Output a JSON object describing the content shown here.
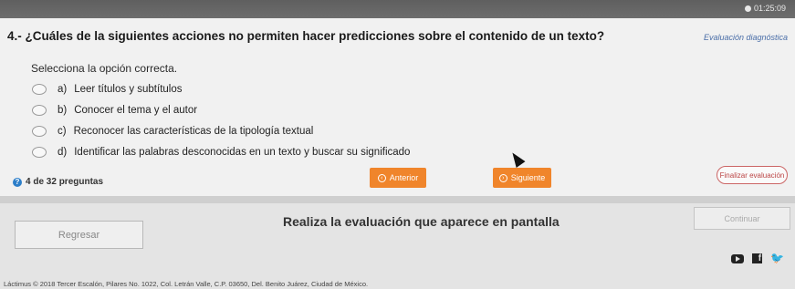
{
  "timer": "01:25:09",
  "question": {
    "title": "4.- ¿Cuáles de la siguientes acciones no permiten hacer predicciones sobre el contenido de un texto?",
    "tag": "Evaluación diagnóstica",
    "instruction": "Selecciona la opción correcta.",
    "options": [
      {
        "letter": "a)",
        "text": "Leer títulos y subtítulos"
      },
      {
        "letter": "b)",
        "text": "Conocer el tema y el autor"
      },
      {
        "letter": "c)",
        "text": "Reconocer las características de la tipología textual"
      },
      {
        "letter": "d)",
        "text": "Identificar las palabras desconocidas en un texto y buscar su significado"
      }
    ]
  },
  "nav": {
    "progress": "4 de 32 preguntas",
    "prev_label": "Anterior",
    "next_label": "Siguiente",
    "finish_label": "Finalizar evaluación"
  },
  "lower": {
    "back_label": "Regresar",
    "notice": "Realiza la evaluación que aparece en pantalla",
    "continue_label": "Continuar",
    "copyright": "Láctimus © 2018 Tercer Escalón, Pilares No. 1022, Col. Letrán Valle, C.P. 03650, Del. Benito Juárez, Ciudad de México."
  },
  "colors": {
    "accent": "#f0852b",
    "tag": "#4a6ea8",
    "finish": "#b44444"
  },
  "icons": [
    "clock-icon",
    "help-icon",
    "arrow-left-icon",
    "arrow-right-icon",
    "youtube-icon",
    "facebook-icon",
    "twitter-icon"
  ]
}
